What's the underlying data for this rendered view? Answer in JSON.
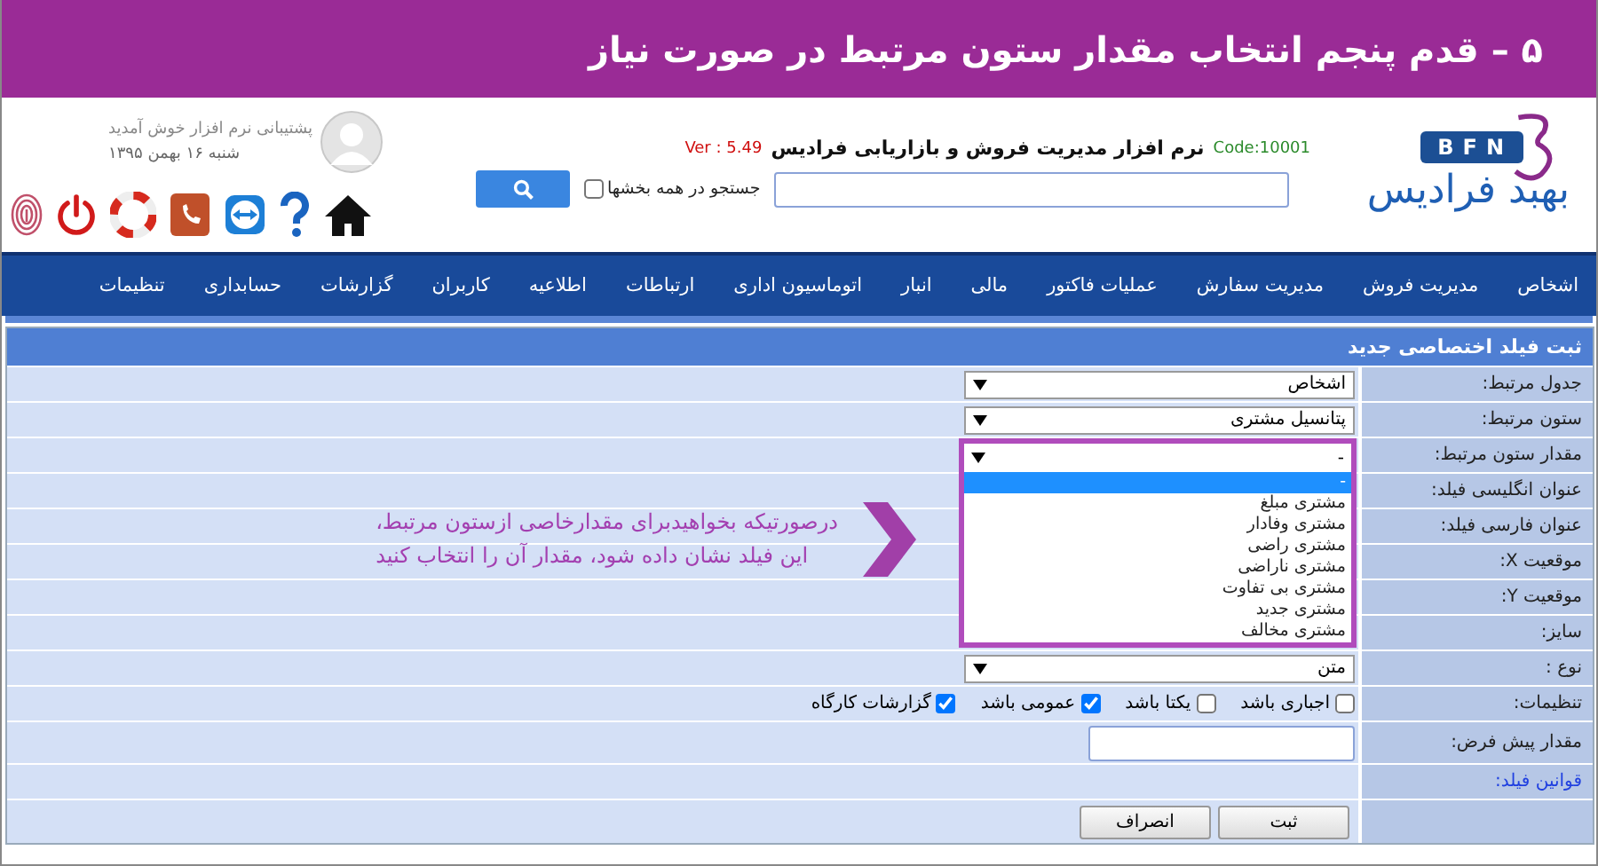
{
  "banner": {
    "title": "۵ – قدم پنجم انتخاب مقدار ستون مرتبط در صورت نیاز"
  },
  "header": {
    "logo": {
      "badge": "BFN",
      "name": "بهبد فرادیس"
    },
    "product": {
      "code": "Code:10001",
      "title": "نرم افزار مدیریت فروش و بازاریابی فرادیس",
      "version": "Ver : 5.49"
    },
    "search": {
      "all_sections": {
        "label": "جستجو در همه بخشها",
        "checked": false
      }
    },
    "user": {
      "welcome": "پشتیبانی نرم افزار خوش آمدید",
      "date": "شنبه ۱۶ بهمن ۱۳۹۵"
    }
  },
  "nav": {
    "items": [
      "اشخاص",
      "مدیریت فروش",
      "مدیریت سفارش",
      "عملیات فاکتور",
      "مالی",
      "انبار",
      "اتوماسیون اداری",
      "ارتباطات",
      "اطلاعیه",
      "کاربران",
      "گزارشات",
      "حسابداری",
      "تنظیمات"
    ]
  },
  "form": {
    "title": "ثبت فیلد اختصاصی جدید",
    "rows": [
      {
        "label": "جدول مرتبط:",
        "kind": "select",
        "value": "اشخاص"
      },
      {
        "label": "ستون مرتبط:",
        "kind": "select",
        "value": "پتانسیل مشتری"
      },
      {
        "label": "مقدار ستون مرتبط:",
        "kind": "select",
        "value": "-",
        "open": true,
        "options": [
          {
            "label": "-",
            "selected": true
          },
          {
            "label": "مشتری مبلغ",
            "selected": false
          },
          {
            "label": "مشتری وفادار",
            "selected": false
          },
          {
            "label": "مشتری راضی",
            "selected": false
          },
          {
            "label": "مشتری ناراضی",
            "selected": false
          },
          {
            "label": "مشتری بی تفاوت",
            "selected": false
          },
          {
            "label": "مشتری جدید",
            "selected": false
          },
          {
            "label": "مشتری مخالف",
            "selected": false
          }
        ]
      },
      {
        "label": "عنوان انگلیسی فیلد:",
        "kind": "blank"
      },
      {
        "label": "عنوان فارسی فیلد:",
        "kind": "blank"
      },
      {
        "label": "موقعیت X:",
        "kind": "blank"
      },
      {
        "label": "موقعیت Y:",
        "kind": "blank"
      },
      {
        "label": "سایز:",
        "kind": "blank"
      },
      {
        "label": "نوع :",
        "kind": "select",
        "value": "متن"
      },
      {
        "label": "تنظیمات:",
        "kind": "checks",
        "options": [
          {
            "label": "اجباری باشد",
            "checked": false
          },
          {
            "label": "یکتا باشد",
            "checked": false
          },
          {
            "label": "عمومی باشد",
            "checked": true
          },
          {
            "label": "گزارشات کارگاه",
            "checked": true
          }
        ]
      },
      {
        "label": "مقدار پیش فرض:",
        "kind": "input"
      },
      {
        "label": "قوانین فیلد:",
        "kind": "link"
      }
    ],
    "buttons": [
      "ثبت",
      "انصراف"
    ]
  },
  "annotation": {
    "lines": [
      "درصورتیکه بخواهیدبرای مقدارخاصی ازستون مرتبط،",
      "این  فیلد نشان داده شود، مقدار آن  را انتخاب  کنید"
    ]
  }
}
